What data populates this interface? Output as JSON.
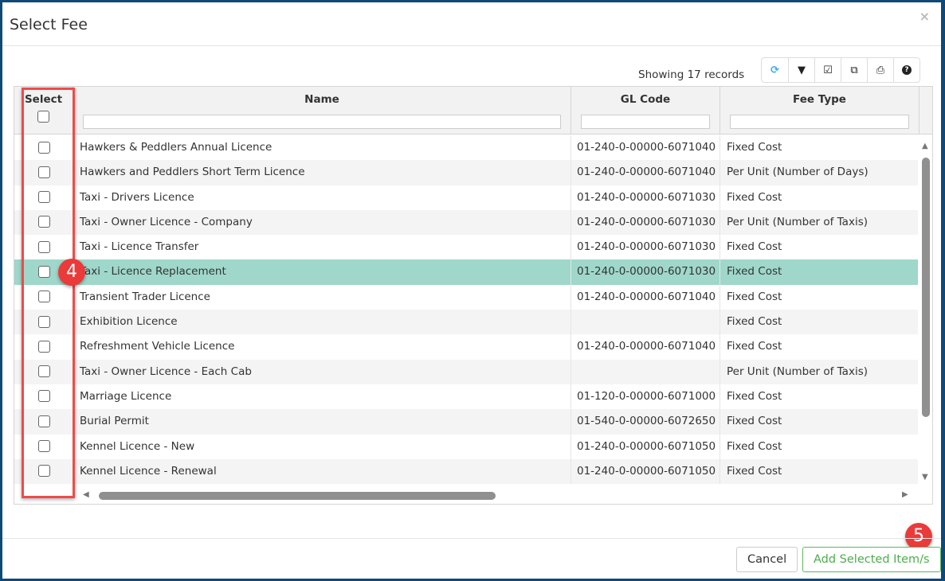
{
  "dialog": {
    "title": "Select Fee",
    "close_icon": "×"
  },
  "toolbar": {
    "showing": "Showing 17 records",
    "buttons": [
      "refresh-icon",
      "filter-icon",
      "check-square-icon",
      "copy-icon",
      "print-icon",
      "help-icon"
    ],
    "refresh_color": "#3ab0e2"
  },
  "columns": {
    "select": "Select",
    "name": "Name",
    "gl_code": "GL Code",
    "fee_type": "Fee Type"
  },
  "rows": [
    {
      "name": "Hawkers & Peddlers Annual Licence",
      "gl": "01-240-0-00000-6071040",
      "type": "Fixed Cost"
    },
    {
      "name": "Hawkers and Peddlers Short Term Licence",
      "gl": "01-240-0-00000-6071040",
      "type": "Per Unit (Number of Days)"
    },
    {
      "name": "Taxi - Drivers Licence",
      "gl": "01-240-0-00000-6071030",
      "type": "Fixed Cost"
    },
    {
      "name": "Taxi - Owner Licence - Company",
      "gl": "01-240-0-00000-6071030",
      "type": "Per Unit (Number of Taxis)"
    },
    {
      "name": "Taxi - Licence Transfer",
      "gl": "01-240-0-00000-6071030",
      "type": "Fixed Cost"
    },
    {
      "name": "Taxi - Licence Replacement",
      "gl": "01-240-0-00000-6071030",
      "type": "Fixed Cost",
      "highlighted": true
    },
    {
      "name": "Transient Trader Licence",
      "gl": "01-240-0-00000-6071040",
      "type": "Fixed Cost"
    },
    {
      "name": "Exhibition Licence",
      "gl": "",
      "type": "Fixed Cost"
    },
    {
      "name": "Refreshment Vehicle Licence",
      "gl": "01-240-0-00000-6071040",
      "type": "Fixed Cost"
    },
    {
      "name": "Taxi - Owner Licence - Each Cab",
      "gl": "",
      "type": "Per Unit (Number of Taxis)"
    },
    {
      "name": "Marriage Licence",
      "gl": "01-120-0-00000-6071000",
      "type": "Fixed Cost"
    },
    {
      "name": "Burial Permit",
      "gl": "01-540-0-00000-6072650",
      "type": "Fixed Cost"
    },
    {
      "name": "Kennel Licence - New",
      "gl": "01-240-0-00000-6071050",
      "type": "Fixed Cost"
    },
    {
      "name": "Kennel Licence - Renewal",
      "gl": "01-240-0-00000-6071050",
      "type": "Fixed Cost"
    }
  ],
  "annotations": {
    "step4": "4",
    "step5": "5",
    "highlight_color": "#ef4a4a"
  },
  "footer": {
    "cancel": "Cancel",
    "add": "Add Selected Item/s"
  }
}
